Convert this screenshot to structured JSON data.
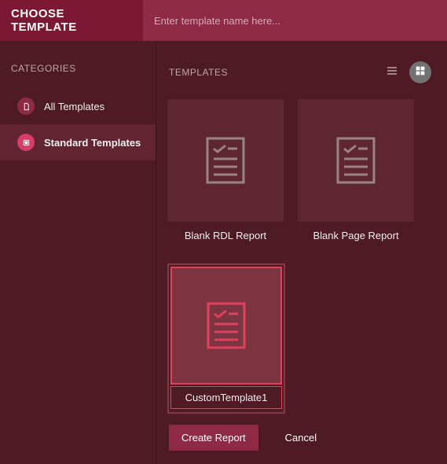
{
  "header": {
    "title": "CHOOSE TEMPLATE",
    "search_placeholder": "Enter template name here..."
  },
  "sidebar": {
    "section_label": "CATEGORIES",
    "items": [
      {
        "label": "All Templates",
        "icon": "file-icon",
        "selected": false
      },
      {
        "label": "Standard Templates",
        "icon": "layers-icon",
        "selected": true
      }
    ]
  },
  "content": {
    "section_label": "TEMPLATES",
    "view_mode": "grid",
    "templates": [
      {
        "label": "Blank RDL Report",
        "selected": false
      },
      {
        "label": "Blank Page Report",
        "selected": false
      },
      {
        "label": "CustomTemplate1",
        "selected": true
      }
    ]
  },
  "footer": {
    "primary_label": "Create Report",
    "secondary_label": "Cancel"
  },
  "colors": {
    "accent": "#e0415e",
    "header": "#7c1834",
    "searchbar": "#8f2a46",
    "background": "#4e1a23"
  }
}
